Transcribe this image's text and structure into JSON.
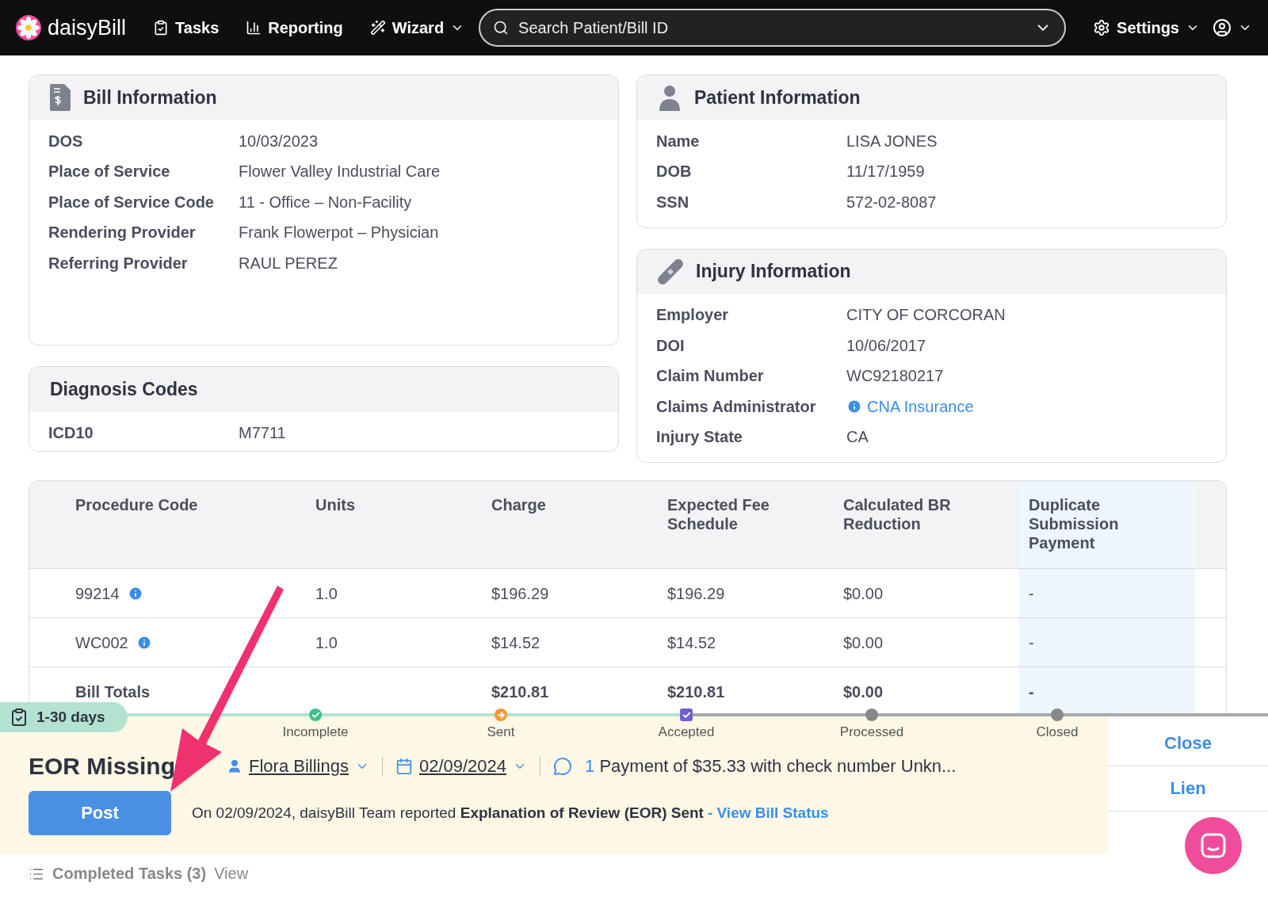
{
  "nav": {
    "logo": "daisyBill",
    "items": [
      {
        "label": "Tasks",
        "kind": "clipboard",
        "dropdown": false
      },
      {
        "label": "Reporting",
        "kind": "chart",
        "dropdown": false
      },
      {
        "label": "Wizard",
        "kind": "wand",
        "dropdown": true
      }
    ],
    "search": {
      "placeholder": "Search Patient/Bill ID"
    },
    "settings": "Settings"
  },
  "bill_information": {
    "title": "Bill Information",
    "rows": [
      {
        "label": "DOS",
        "value": "10/03/2023"
      },
      {
        "label": "Place of Service",
        "value": "Flower Valley Industrial Care"
      },
      {
        "label": "Place of Service Code",
        "value": "11 - Office – Non-Facility"
      },
      {
        "label": "Rendering Provider",
        "value": "Frank Flowerpot – Physician"
      },
      {
        "label": "Referring Provider",
        "value": "RAUL PEREZ"
      }
    ]
  },
  "diagnosis_codes": {
    "title": "Diagnosis Codes",
    "rows": [
      {
        "label": "ICD10",
        "value": "M7711"
      }
    ]
  },
  "patient_information": {
    "title": "Patient Information",
    "rows": [
      {
        "label": "Name",
        "value": "LISA JONES"
      },
      {
        "label": "DOB",
        "value": "11/17/1959"
      },
      {
        "label": "SSN",
        "value": "572-02-8087"
      }
    ]
  },
  "injury_information": {
    "title": "Injury Information",
    "rows": [
      {
        "label": "Employer",
        "value": "CITY OF CORCORAN"
      },
      {
        "label": "DOI",
        "value": "10/06/2017"
      },
      {
        "label": "Claim Number",
        "value": "WC92180217"
      },
      {
        "label": "Claims Administrator",
        "value": "CNA Insurance",
        "kind": "link"
      },
      {
        "label": "Injury State",
        "value": "CA"
      }
    ]
  },
  "table": {
    "columns": [
      {
        "label": "Procedure Code",
        "highlighted": false
      },
      {
        "label": "Units",
        "highlighted": false
      },
      {
        "label": "Charge",
        "highlighted": false
      },
      {
        "label": "Expected Fee Schedule",
        "highlighted": false
      },
      {
        "label": "Calculated BR Reduction",
        "highlighted": false
      },
      {
        "label": "Duplicate Submission Payment",
        "highlighted": true
      }
    ],
    "rows": [
      {
        "cells": [
          "99214",
          "1.0",
          "$196.29",
          "$196.29",
          "$0.00",
          "-"
        ],
        "info": true,
        "total": false
      },
      {
        "cells": [
          "WC002",
          "1.0",
          "$14.52",
          "$14.52",
          "$0.00",
          "-"
        ],
        "info": true,
        "total": false
      },
      {
        "cells": [
          "Bill Totals",
          "",
          "$210.81",
          "$210.81",
          "$0.00",
          "-"
        ],
        "info": false,
        "total": true
      }
    ]
  },
  "task": {
    "age_tag": "1-30 days",
    "steps": [
      {
        "label": "Incomplete",
        "kind": "done"
      },
      {
        "label": "Sent",
        "kind": "current"
      },
      {
        "label": "Accepted",
        "kind": "checked"
      },
      {
        "label": "Processed",
        "kind": "pending"
      },
      {
        "label": "Closed",
        "kind": "pending"
      }
    ],
    "title": "EOR Missing",
    "assignee": "Flora Billings",
    "date": "02/09/2024",
    "comment_count": "1",
    "comment": "Payment of $35.33 with check number Unkn...",
    "post_button": "Post",
    "message": "On 02/09/2024, daisyBill Team reported **Explanation of Review (EOR) Sent**",
    "message_link": "- View Bill Status",
    "actions": [
      "Close",
      "Lien"
    ]
  },
  "completed_tasks": {
    "label": "Completed Tasks (3)",
    "link": "View"
  }
}
